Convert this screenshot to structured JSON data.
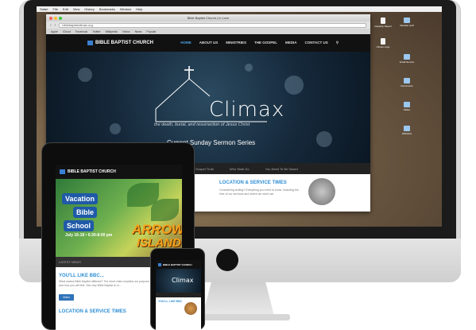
{
  "site": {
    "name": "BIBLE BAPTIST CHURCH",
    "nav": [
      "HOME",
      "ABOUT US",
      "MINISTRIES",
      "THE GOSPEL",
      "MEDIA",
      "CONTACT US"
    ],
    "url": "biblebaptistclimax.org"
  },
  "desktop": {
    "menubar": [
      "Safari",
      "File",
      "Edit",
      "View",
      "History",
      "Bookmarks",
      "Window",
      "Help"
    ],
    "icons": [
      {
        "label": "Capacity Report",
        "kind": "file"
      },
      {
        "label": "Website stuff",
        "kind": "folder"
      },
      {
        "label": "Climax Logo",
        "kind": "file"
      },
      {
        "label": "Email Service",
        "kind": "folder"
      },
      {
        "label": "Documents",
        "kind": "folder"
      },
      {
        "label": "Slides",
        "kind": "folder"
      },
      {
        "label": "Websites",
        "kind": "folder"
      }
    ]
  },
  "browser": {
    "tab_title": "Bible Baptist Church | In Love",
    "bookmarks": [
      "Apple",
      "iCloud",
      "Facebook",
      "Twitter",
      "Wikipedia",
      "Yahoo",
      "News",
      "Popular"
    ]
  },
  "hero": {
    "title": "Climax",
    "subtitle": "the death, burial, and resurrection of Jesus Christ",
    "series": "Current Sunday Sermon Series"
  },
  "strip": {
    "items": [
      "The Gospel Truth",
      "Who Shall Go",
      "You Need To Be Saved"
    ]
  },
  "location": {
    "title": "LOCATION & SERVICE TIMES",
    "text": "Considering visiting? Everything you need to know. Including the time of our services and where we meet can"
  },
  "tablet": {
    "promo": {
      "line1": "Vacation",
      "line2": "Bible",
      "line3": "School",
      "arrow": "ARROW",
      "island": "ISLAND",
      "date": "July 16-18 • 6:30-8:00 pm"
    },
    "latest": "LATEST NEWS",
    "like_title": "YOU'LL LIKE BBC...",
    "like_text": "What makes Bible Baptist different? The short video explains our purpose and how you will feel. See why Bible Baptist is m...",
    "like_btn": "Video",
    "loc_title": "LOCATION & SERVICE TIMES"
  },
  "phone": {
    "hero_title": "Climax",
    "section": "YOU'LL LIKE BBC"
  },
  "colors": {
    "accent": "#2f8fd6",
    "nav_bg": "#111111",
    "hero_bg": "#15283a"
  }
}
